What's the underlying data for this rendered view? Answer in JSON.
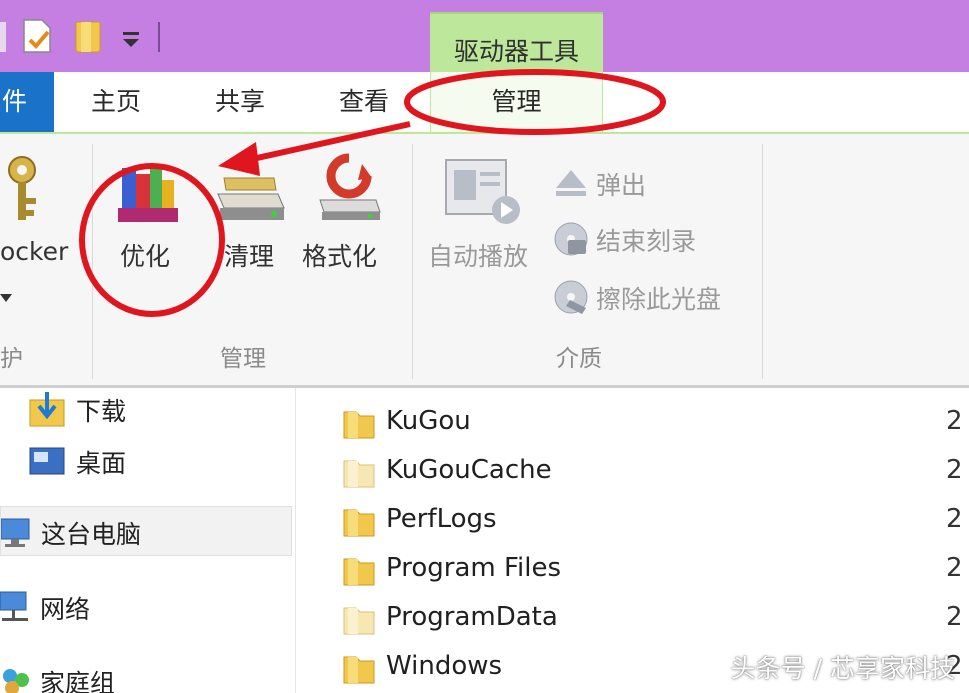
{
  "title_bar": {
    "context_tab_header": "驱动器工具",
    "quick_access": [
      "properties-icon",
      "new-folder-icon",
      "dropdown-icon"
    ]
  },
  "ribbon": {
    "tabs": {
      "file": "件",
      "home": "主页",
      "share": "共享",
      "view": "查看",
      "manage": "管理"
    },
    "groups": {
      "protect": {
        "label": "护",
        "bitlocker_label": "ocker"
      },
      "manage": {
        "label": "管理",
        "optimize": "优化",
        "cleanup": "清理",
        "format": "格式化"
      },
      "media": {
        "label": "介质",
        "autoplay": "自动播放",
        "eject": "弹出",
        "finish_burning": "结束刻录",
        "erase_disc": "擦除此光盘"
      }
    }
  },
  "nav_pane": {
    "items": [
      "下载",
      "桌面",
      "这台电脑",
      "网络",
      "家庭组"
    ]
  },
  "file_list": {
    "rows": [
      {
        "name": "KuGou",
        "date": "2"
      },
      {
        "name": "KuGouCache",
        "date": "2"
      },
      {
        "name": "PerfLogs",
        "date": "2"
      },
      {
        "name": "Program Files",
        "date": "2"
      },
      {
        "name": "ProgramData",
        "date": "2"
      },
      {
        "name": "Windows",
        "date": "2"
      }
    ]
  },
  "watermark": "头条号 / 芯享家科技",
  "colors": {
    "title_bar": "#c57fe2",
    "context_tab": "#bde79a",
    "file_tab": "#1a73c8",
    "annotation_red": "#e0161e"
  }
}
